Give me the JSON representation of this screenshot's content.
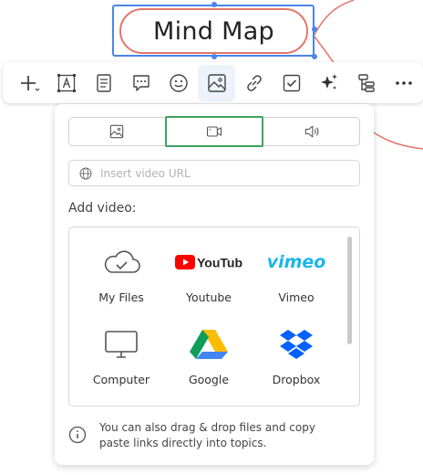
{
  "topic": {
    "title": "Mind Map"
  },
  "toolbar": {
    "items": [
      {
        "name": "add-topic",
        "icon": "plus-dropdown-icon"
      },
      {
        "name": "text",
        "icon": "text-frame-icon"
      },
      {
        "name": "note",
        "icon": "note-icon"
      },
      {
        "name": "comment",
        "icon": "comment-icon"
      },
      {
        "name": "emoji",
        "icon": "smiley-icon"
      },
      {
        "name": "image",
        "icon": "image-icon",
        "active": true
      },
      {
        "name": "link",
        "icon": "link-icon"
      },
      {
        "name": "task",
        "icon": "checkbox-icon"
      },
      {
        "name": "ai",
        "icon": "sparkle-icon"
      },
      {
        "name": "structure",
        "icon": "structure-icon"
      },
      {
        "name": "more",
        "icon": "more-icon"
      }
    ]
  },
  "media_panel": {
    "tabs": [
      {
        "name": "image",
        "icon": "image-icon"
      },
      {
        "name": "video",
        "icon": "video-icon",
        "selected": true
      },
      {
        "name": "audio",
        "icon": "speaker-icon"
      }
    ],
    "url_placeholder": "Insert video URL",
    "url_value": "",
    "add_label": "Add video:",
    "sources": [
      {
        "label": "My Files",
        "icon": "cloud-icon"
      },
      {
        "label": "Youtube",
        "icon": "youtube-logo",
        "logo_text": "YouTube"
      },
      {
        "label": "Vimeo",
        "icon": "vimeo-logo",
        "logo_text": "vimeo"
      },
      {
        "label": "Computer",
        "icon": "monitor-icon"
      },
      {
        "label": "Google",
        "icon": "google-drive-logo"
      },
      {
        "label": "Dropbox",
        "icon": "dropbox-logo"
      }
    ],
    "footer_note": "You can also drag & drop files and copy paste links directly into topics."
  },
  "colors": {
    "topic_border": "#e1766b",
    "selection": "#4a86e8",
    "tab_selected_border": "#3fa35f",
    "youtube_red": "#ff0000",
    "vimeo_blue": "#1ab7ea",
    "dropbox_blue": "#0061fe"
  }
}
